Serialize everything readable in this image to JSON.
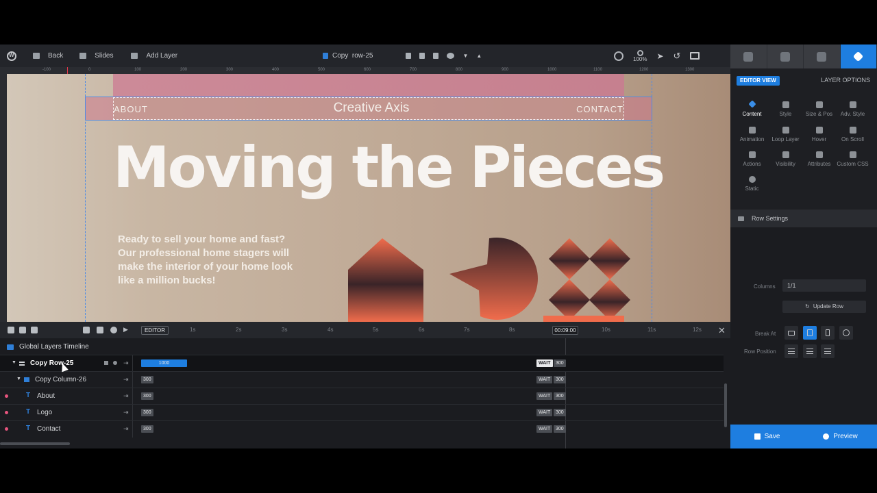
{
  "toolbar": {
    "back": "Back",
    "slides": "Slides",
    "add_layer": "Add Layer",
    "slide_name": "Copy  row-25",
    "zoom": "100%"
  },
  "canvas": {
    "nav_left": "ABOUT",
    "nav_logo": "Creative Axis",
    "nav_right": "CONTACT",
    "headline": "Moving the Pieces",
    "sub_lines": [
      "Ready to sell your home and fast?",
      "Our professional home stagers will",
      "make the interior of your home look",
      "like a million bucks!"
    ],
    "ruler_ticks": [
      "-100",
      "0",
      "100",
      "200",
      "300",
      "400",
      "500",
      "600",
      "700",
      "800",
      "900",
      "1000",
      "1100",
      "1200",
      "1300"
    ]
  },
  "timeline": {
    "editor_label": "EDITOR",
    "seconds": [
      "1s",
      "2s",
      "3s",
      "4s",
      "5s",
      "6s",
      "7s",
      "8s",
      "10s",
      "11s",
      "12s"
    ],
    "current_time": "00:09:00",
    "title": "Global Layers Timeline",
    "rows": [
      {
        "name": "Copy Row-25",
        "start": "1000",
        "end": "300",
        "wait": "WAIT"
      },
      {
        "name": "Copy Column-26",
        "start": "300",
        "end": "300",
        "wait": "WAIT"
      },
      {
        "name": "About",
        "start": "300",
        "end": "300",
        "wait": "WAIT"
      },
      {
        "name": "Logo",
        "start": "300",
        "end": "300",
        "wait": "WAIT"
      },
      {
        "name": "Contact",
        "start": "300",
        "end": "300",
        "wait": "WAIT"
      }
    ]
  },
  "panel": {
    "editor_view": "EDITOR VIEW",
    "layer_options": "LAYER OPTIONS",
    "options": [
      "Content",
      "Style",
      "Size & Pos",
      "Adv. Style",
      "Animation",
      "Loop Layer",
      "Hover",
      "On Scroll",
      "Actions",
      "Visibility",
      "Attributes",
      "Custom CSS",
      "Static"
    ],
    "row_settings": "Row Settings",
    "columns_label": "Columns",
    "columns_value": "1/1",
    "update_row": "Update Row",
    "break_at": "Break At",
    "row_position": "Row Position",
    "save": "Save",
    "preview": "Preview"
  },
  "colors": {
    "accent": "#1e7ee0",
    "canvas_bg": "#c0aa96",
    "pink_row": "#cc8a98",
    "shape_orange": "#f06c4c",
    "shape_dark": "#3a2428"
  }
}
